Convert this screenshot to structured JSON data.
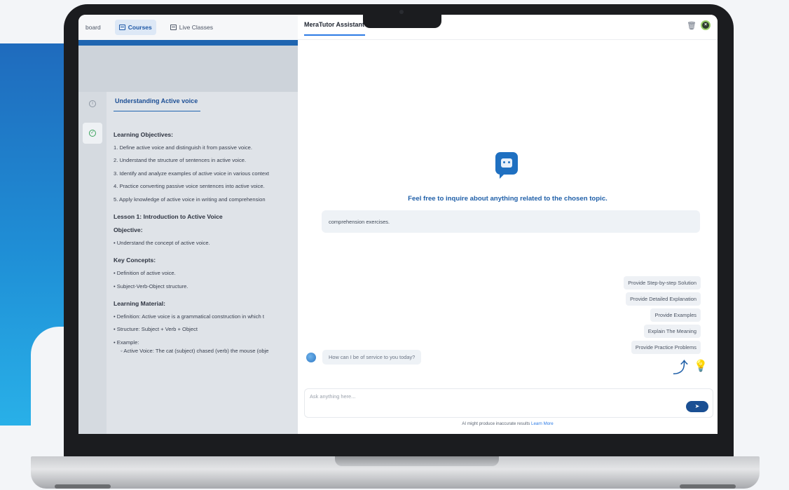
{
  "colors": {
    "brand_blue": "#1f65b0",
    "accent": "#2c7be5",
    "welcome_text": "#1f5fa8",
    "send_button": "#1a4f93"
  },
  "nav": {
    "items": [
      {
        "label": "board",
        "icon": "dashboard-icon",
        "active": false
      },
      {
        "label": "Courses",
        "icon": "courses-icon",
        "active": true
      },
      {
        "label": "Live Classes",
        "icon": "live-classes-icon",
        "active": false
      }
    ]
  },
  "lesson": {
    "tab_title": "Understanding Active voice",
    "objectives_heading": "Learning Objectives:",
    "objectives": [
      "1. Define active voice and distinguish it from passive voice.",
      "2. Understand the structure of sentences in active voice.",
      "3. Identify and analyze examples of active voice in various context",
      "4. Practice converting passive voice sentences into active voice.",
      "5. Apply knowledge of active voice in writing and comprehension"
    ],
    "lesson1_title": "Lesson 1: Introduction to Active Voice",
    "objective_label": "Objective:",
    "objective_text": "•  Understand the concept of active voice.",
    "key_concepts_label": "Key Concepts:",
    "key_concepts": [
      "•  Definition of active voice.",
      "•  Subject-Verb-Object structure."
    ],
    "material_label": "Learning Material:",
    "material": [
      "•  Definition: Active voice is a grammatical construction in which t",
      "•  Structure: Subject + Verb + Object",
      "•  Example:"
    ],
    "example_sub": "◦  Active Voice: The cat (subject) chased (verb) the mouse (obje"
  },
  "chat": {
    "title": "MeraTutor Assistant",
    "welcome": "Feel free to inquire about anything related to the chosen topic.",
    "prompt": "comprehension exercises.",
    "suggestions": [
      "Provide Step-by-step Solution",
      "Provide Detailed Explanation",
      "Provide Examples",
      "Explain The Meaning",
      "Provide Practice Problems"
    ],
    "assistant_message": "How can I be of service to you today?",
    "input_placeholder": "Ask anything here...",
    "disclaimer": "AI might produce inaccurate results",
    "learn_more": "Learn More"
  }
}
